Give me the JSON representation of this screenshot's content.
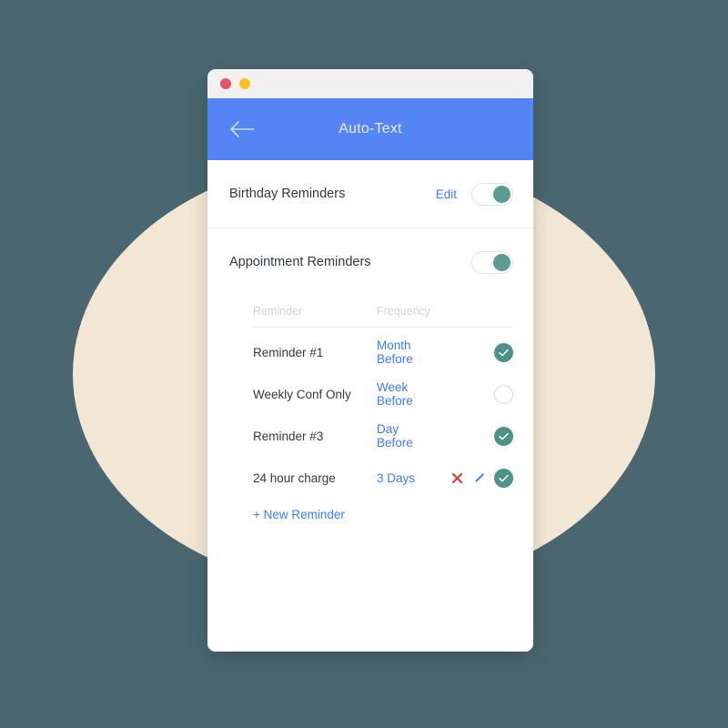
{
  "window": {
    "titlebar": {
      "buttons": [
        {
          "name": "close",
          "color": "#e0556a"
        },
        {
          "name": "minimize",
          "color": "#f5c220"
        }
      ]
    },
    "appbar": {
      "title": "Auto-Text",
      "back_icon": "back-arrow-icon",
      "bg": "#5585f5"
    }
  },
  "birthday_section": {
    "title": "Birthday Reminders",
    "edit_label": "Edit",
    "toggle_state": "on"
  },
  "appointment_section": {
    "title": "Appointment Reminders",
    "toggle_state": "on",
    "table": {
      "headers": {
        "name": "Reminder",
        "frequency": "Frequency"
      },
      "rows": [
        {
          "name": "Reminder #1",
          "frequency": "Month Before",
          "status": "on",
          "has_delete": false,
          "has_edit": false
        },
        {
          "name": "Weekly Conf Only",
          "frequency": "Week Before",
          "status": "off",
          "has_delete": false,
          "has_edit": false
        },
        {
          "name": "Reminder #3",
          "frequency": "Day Before",
          "status": "on",
          "has_delete": false,
          "has_edit": false
        },
        {
          "name": "24 hour charge",
          "frequency": "3 Days",
          "status": "on",
          "has_delete": true,
          "has_edit": true
        }
      ]
    },
    "new_reminder_label": "+ New Reminder"
  },
  "colors": {
    "background": "#4a6670",
    "blob": "#f2e6d4",
    "accent_blue": "#3d7bf7",
    "header_blue": "#5585f5",
    "toggle_green": "#5a9b92",
    "status_green": "#4e9188",
    "delete_red": "#d93f3f",
    "edit_blue": "#2f6ef0"
  }
}
